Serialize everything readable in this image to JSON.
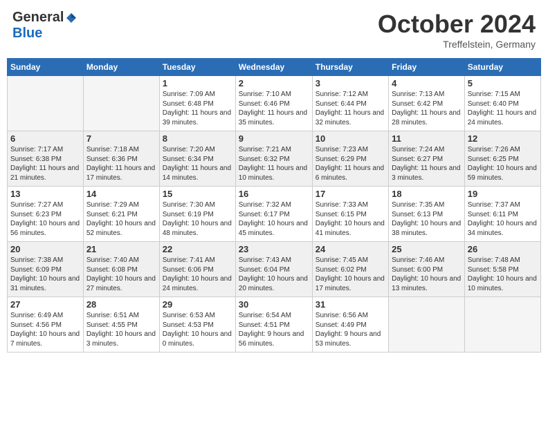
{
  "logo": {
    "general": "General",
    "blue": "Blue"
  },
  "title": {
    "month": "October 2024",
    "location": "Treffelstein, Germany"
  },
  "weekdays": [
    "Sunday",
    "Monday",
    "Tuesday",
    "Wednesday",
    "Thursday",
    "Friday",
    "Saturday"
  ],
  "weeks": [
    [
      {
        "day": "",
        "info": ""
      },
      {
        "day": "",
        "info": ""
      },
      {
        "day": "1",
        "info": "Sunrise: 7:09 AM\nSunset: 6:48 PM\nDaylight: 11 hours and 39 minutes."
      },
      {
        "day": "2",
        "info": "Sunrise: 7:10 AM\nSunset: 6:46 PM\nDaylight: 11 hours and 35 minutes."
      },
      {
        "day": "3",
        "info": "Sunrise: 7:12 AM\nSunset: 6:44 PM\nDaylight: 11 hours and 32 minutes."
      },
      {
        "day": "4",
        "info": "Sunrise: 7:13 AM\nSunset: 6:42 PM\nDaylight: 11 hours and 28 minutes."
      },
      {
        "day": "5",
        "info": "Sunrise: 7:15 AM\nSunset: 6:40 PM\nDaylight: 11 hours and 24 minutes."
      }
    ],
    [
      {
        "day": "6",
        "info": "Sunrise: 7:17 AM\nSunset: 6:38 PM\nDaylight: 11 hours and 21 minutes."
      },
      {
        "day": "7",
        "info": "Sunrise: 7:18 AM\nSunset: 6:36 PM\nDaylight: 11 hours and 17 minutes."
      },
      {
        "day": "8",
        "info": "Sunrise: 7:20 AM\nSunset: 6:34 PM\nDaylight: 11 hours and 14 minutes."
      },
      {
        "day": "9",
        "info": "Sunrise: 7:21 AM\nSunset: 6:32 PM\nDaylight: 11 hours and 10 minutes."
      },
      {
        "day": "10",
        "info": "Sunrise: 7:23 AM\nSunset: 6:29 PM\nDaylight: 11 hours and 6 minutes."
      },
      {
        "day": "11",
        "info": "Sunrise: 7:24 AM\nSunset: 6:27 PM\nDaylight: 11 hours and 3 minutes."
      },
      {
        "day": "12",
        "info": "Sunrise: 7:26 AM\nSunset: 6:25 PM\nDaylight: 10 hours and 59 minutes."
      }
    ],
    [
      {
        "day": "13",
        "info": "Sunrise: 7:27 AM\nSunset: 6:23 PM\nDaylight: 10 hours and 56 minutes."
      },
      {
        "day": "14",
        "info": "Sunrise: 7:29 AM\nSunset: 6:21 PM\nDaylight: 10 hours and 52 minutes."
      },
      {
        "day": "15",
        "info": "Sunrise: 7:30 AM\nSunset: 6:19 PM\nDaylight: 10 hours and 48 minutes."
      },
      {
        "day": "16",
        "info": "Sunrise: 7:32 AM\nSunset: 6:17 PM\nDaylight: 10 hours and 45 minutes."
      },
      {
        "day": "17",
        "info": "Sunrise: 7:33 AM\nSunset: 6:15 PM\nDaylight: 10 hours and 41 minutes."
      },
      {
        "day": "18",
        "info": "Sunrise: 7:35 AM\nSunset: 6:13 PM\nDaylight: 10 hours and 38 minutes."
      },
      {
        "day": "19",
        "info": "Sunrise: 7:37 AM\nSunset: 6:11 PM\nDaylight: 10 hours and 34 minutes."
      }
    ],
    [
      {
        "day": "20",
        "info": "Sunrise: 7:38 AM\nSunset: 6:09 PM\nDaylight: 10 hours and 31 minutes."
      },
      {
        "day": "21",
        "info": "Sunrise: 7:40 AM\nSunset: 6:08 PM\nDaylight: 10 hours and 27 minutes."
      },
      {
        "day": "22",
        "info": "Sunrise: 7:41 AM\nSunset: 6:06 PM\nDaylight: 10 hours and 24 minutes."
      },
      {
        "day": "23",
        "info": "Sunrise: 7:43 AM\nSunset: 6:04 PM\nDaylight: 10 hours and 20 minutes."
      },
      {
        "day": "24",
        "info": "Sunrise: 7:45 AM\nSunset: 6:02 PM\nDaylight: 10 hours and 17 minutes."
      },
      {
        "day": "25",
        "info": "Sunrise: 7:46 AM\nSunset: 6:00 PM\nDaylight: 10 hours and 13 minutes."
      },
      {
        "day": "26",
        "info": "Sunrise: 7:48 AM\nSunset: 5:58 PM\nDaylight: 10 hours and 10 minutes."
      }
    ],
    [
      {
        "day": "27",
        "info": "Sunrise: 6:49 AM\nSunset: 4:56 PM\nDaylight: 10 hours and 7 minutes."
      },
      {
        "day": "28",
        "info": "Sunrise: 6:51 AM\nSunset: 4:55 PM\nDaylight: 10 hours and 3 minutes."
      },
      {
        "day": "29",
        "info": "Sunrise: 6:53 AM\nSunset: 4:53 PM\nDaylight: 10 hours and 0 minutes."
      },
      {
        "day": "30",
        "info": "Sunrise: 6:54 AM\nSunset: 4:51 PM\nDaylight: 9 hours and 56 minutes."
      },
      {
        "day": "31",
        "info": "Sunrise: 6:56 AM\nSunset: 4:49 PM\nDaylight: 9 hours and 53 minutes."
      },
      {
        "day": "",
        "info": ""
      },
      {
        "day": "",
        "info": ""
      }
    ]
  ]
}
